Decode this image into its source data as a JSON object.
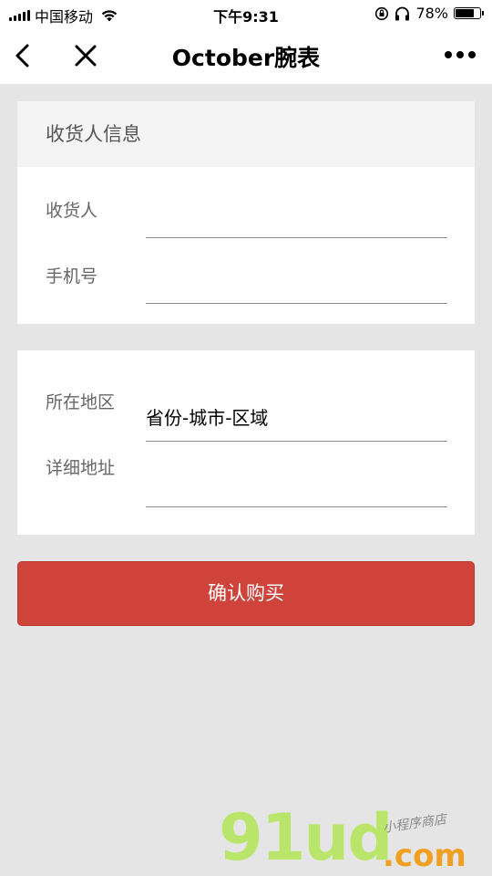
{
  "status_bar": {
    "carrier": "中国移动",
    "time": "下午9:31",
    "battery": "78%",
    "battery_level": 0.78,
    "icons": [
      "signal-icon",
      "wifi-icon",
      "orientation-lock-icon",
      "headphones-icon",
      "battery-icon"
    ]
  },
  "nav": {
    "title": "October腕表",
    "icons": [
      "back-arrow-icon",
      "close-icon",
      "more-dots-icon"
    ]
  },
  "consignee_section": {
    "header": "收货人信息",
    "name_label": "收货人",
    "name_value": "",
    "phone_label": "手机号",
    "phone_value": ""
  },
  "address_section": {
    "region_label": "所在地区",
    "region_value": "省份-城市-区域",
    "detail_label": "详细地址",
    "detail_value": ""
  },
  "confirm_button": {
    "label": "确认购买",
    "color": "#d0433b"
  },
  "watermark": {
    "logo": "91ud",
    "domain": ".com",
    "tagline": "小程序商店"
  }
}
